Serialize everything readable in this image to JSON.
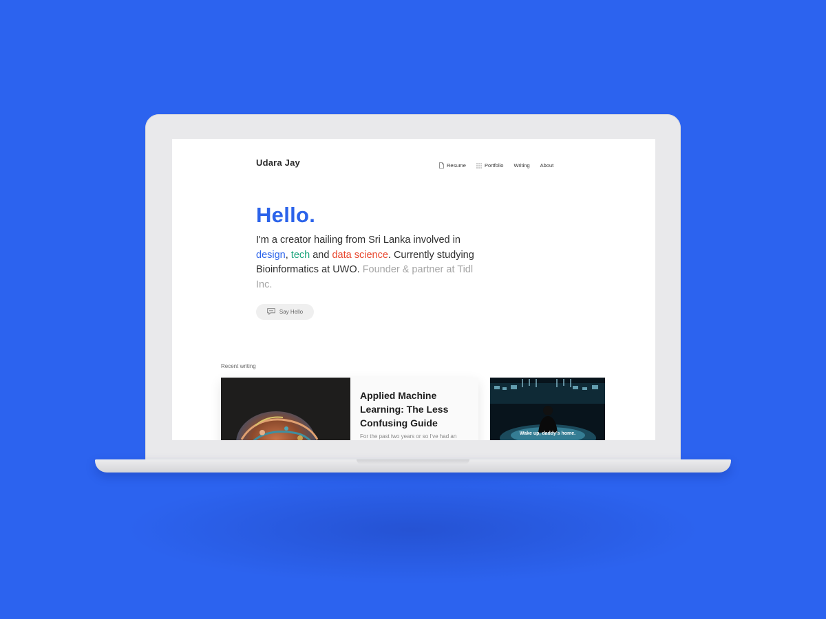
{
  "site": {
    "brand": "Udara Jay"
  },
  "nav": {
    "items": [
      {
        "label": "Resume",
        "icon": "document-icon"
      },
      {
        "label": "Portfolio",
        "icon": "grid-icon"
      },
      {
        "label": "Writing",
        "icon": ""
      },
      {
        "label": "About",
        "icon": ""
      }
    ]
  },
  "hero": {
    "heading": "Hello.",
    "intro_prefix": "I'm a creator hailing from Sri Lanka involved in ",
    "highlight_design": "design",
    "comma": ",",
    "highlight_tech": "tech",
    "and_text": " and ",
    "highlight_data": "data science",
    "intro_suffix": ". Currently studying Bioinformatics at UWO.",
    "muted_text": " Founder & partner at Tidl Inc.",
    "button_label": "Say Hello",
    "button_icon": "chat-icon"
  },
  "recent": {
    "label": "Recent writing",
    "posts": [
      {
        "title": "Applied Machine Learning: The Less Confusing Guide",
        "excerpt": "For the past two years or so I've had an"
      },
      {
        "caption": "Wake up, daddy's home."
      }
    ]
  },
  "colors": {
    "background": "#2c63ef",
    "accent": "#2b63ea",
    "tech": "#1aa37a",
    "data": "#e8452c",
    "muted": "#a5a5a5"
  }
}
